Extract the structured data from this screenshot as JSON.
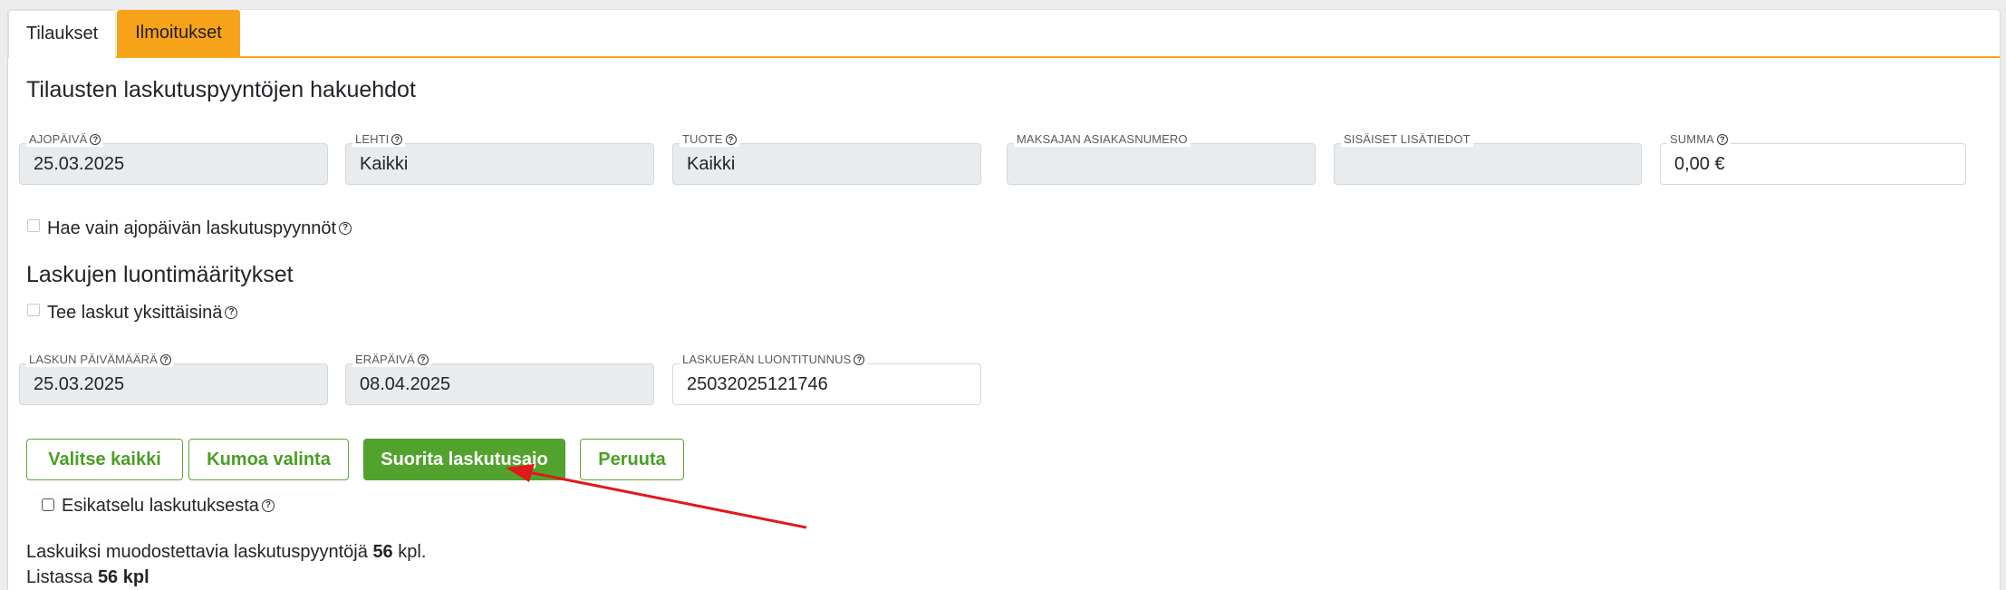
{
  "tabs": [
    {
      "label": "Tilaukset",
      "active": true
    },
    {
      "label": "Ilmoitukset",
      "active": false
    }
  ],
  "search": {
    "title": "Tilausten laskutuspyyntöjen hakuehdot",
    "fields": {
      "ajopaiva": {
        "label": "AJOPÄIVÄ",
        "value": "25.03.2025"
      },
      "lehti": {
        "label": "LEHTI",
        "value": "Kaikki"
      },
      "tuote": {
        "label": "TUOTE",
        "value": "Kaikki"
      },
      "asiakasnumero": {
        "label": "MAKSAJAN ASIAKASNUMERO",
        "value": ""
      },
      "lisatiedot": {
        "label": "SISÄISET LISÄTIEDOT",
        "value": ""
      },
      "summa": {
        "label": "SUMMA",
        "value": "0,00 €"
      }
    },
    "only_run_day_label": "Hae vain ajopäivän laskutuspyynnöt"
  },
  "creation": {
    "title": "Laskujen luontimääritykset",
    "individual_label": "Tee laskut yksittäisinä",
    "fields": {
      "laskun_pvm": {
        "label": "LASKUN PÄIVÄMÄÄRÄ",
        "value": "25.03.2025"
      },
      "erapaiva": {
        "label": "ERÄPÄIVÄ",
        "value": "08.04.2025"
      },
      "luontitunnus": {
        "label": "LASKUERÄN LUONTITUNNUS",
        "value": "25032025121746"
      }
    }
  },
  "buttons": {
    "select_all": "Valitse kaikki",
    "undo_selection": "Kumoa valinta",
    "run_billing": "Suorita laskutusajo",
    "cancel": "Peruuta"
  },
  "preview_label": "Esikatselu laskutuksesta",
  "summary": {
    "line1_prefix": "Laskuiksi muodostettavia laskutuspyyntöjä",
    "line1_count": "56",
    "line1_suffix": "kpl.",
    "line2_prefix": "Listassa",
    "line2_count": "56 kpl"
  },
  "help_glyph": "?",
  "colors": {
    "tab_accent": "#f7a31a",
    "primary_green": "#52a32e",
    "annotation_arrow": "#e0191d"
  },
  "icons": {
    "help": "question-circle-icon",
    "annotation": "red-arrow-icon"
  }
}
